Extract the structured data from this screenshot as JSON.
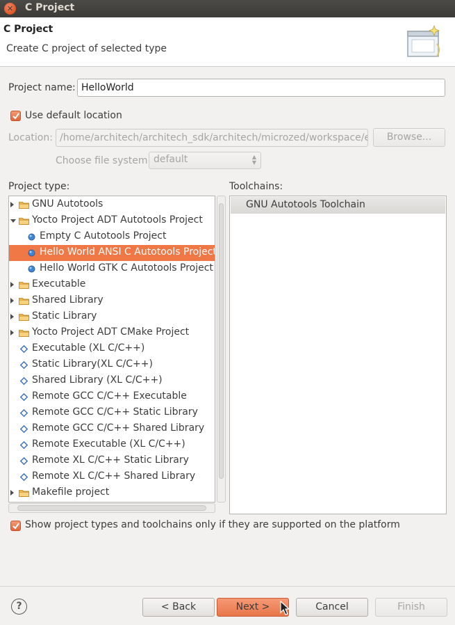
{
  "window": {
    "title": "C Project"
  },
  "banner": {
    "title": "C Project",
    "description": "Create C project of selected type"
  },
  "form": {
    "project_name_label": "Project name:",
    "project_name_value": "HelloWorld",
    "use_default_location_label": "Use default location",
    "use_default_location_checked": true,
    "location_label": "Location:",
    "location_value": "/home/architech/architech_sdk/architech/microzed/workspace/e(",
    "browse_label": "Browse...",
    "file_system_label": "Choose file system:",
    "file_system_value": "default"
  },
  "project_type": {
    "label": "Project type:",
    "items": [
      {
        "label": "GNU Autotools",
        "kind": "folder",
        "expander": "closed",
        "level": 0
      },
      {
        "label": "Yocto Project ADT Autotools Project",
        "kind": "folder",
        "expander": "open",
        "level": 0
      },
      {
        "label": "Empty C Autotools Project",
        "kind": "bullet",
        "expander": "none",
        "level": 1
      },
      {
        "label": "Hello World ANSI C Autotools Project",
        "kind": "bullet",
        "expander": "none",
        "level": 1,
        "selected": true
      },
      {
        "label": "Hello World GTK C Autotools Project",
        "kind": "bullet",
        "expander": "none",
        "level": 1
      },
      {
        "label": "Executable",
        "kind": "folder",
        "expander": "closed",
        "level": 0
      },
      {
        "label": "Shared Library",
        "kind": "folder",
        "expander": "closed",
        "level": 0
      },
      {
        "label": "Static Library",
        "kind": "folder",
        "expander": "closed",
        "level": 0
      },
      {
        "label": "Yocto Project ADT CMake Project",
        "kind": "folder",
        "expander": "closed",
        "level": 0
      },
      {
        "label": "Executable (XL C/C++)",
        "kind": "diamond",
        "expander": "none",
        "level": 0
      },
      {
        "label": "Static Library(XL C/C++)",
        "kind": "diamond",
        "expander": "none",
        "level": 0
      },
      {
        "label": "Shared Library (XL C/C++)",
        "kind": "diamond",
        "expander": "none",
        "level": 0
      },
      {
        "label": "Remote GCC C/C++ Executable",
        "kind": "diamond",
        "expander": "none",
        "level": 0
      },
      {
        "label": "Remote GCC C/C++ Static Library",
        "kind": "diamond",
        "expander": "none",
        "level": 0
      },
      {
        "label": "Remote GCC C/C++ Shared Library",
        "kind": "diamond",
        "expander": "none",
        "level": 0
      },
      {
        "label": "Remote Executable (XL C/C++)",
        "kind": "diamond",
        "expander": "none",
        "level": 0
      },
      {
        "label": "Remote XL C/C++ Static Library",
        "kind": "diamond",
        "expander": "none",
        "level": 0
      },
      {
        "label": "Remote XL C/C++ Shared Library",
        "kind": "diamond",
        "expander": "none",
        "level": 0
      },
      {
        "label": "Makefile project",
        "kind": "folder",
        "expander": "closed",
        "level": 0
      }
    ]
  },
  "toolchains": {
    "label": "Toolchains:",
    "items": [
      "GNU Autotools Toolchain"
    ]
  },
  "show_supported": {
    "label": "Show project types and toolchains only if they are supported on the platform",
    "checked": true
  },
  "buttons": {
    "help": "?",
    "back": "< Back",
    "next": "Next >",
    "cancel": "Cancel",
    "finish": "Finish"
  },
  "colors": {
    "accent": "#f07746",
    "selection": "#f07746",
    "bullet": "#3a7bd5",
    "folder": "#f0b44c"
  }
}
